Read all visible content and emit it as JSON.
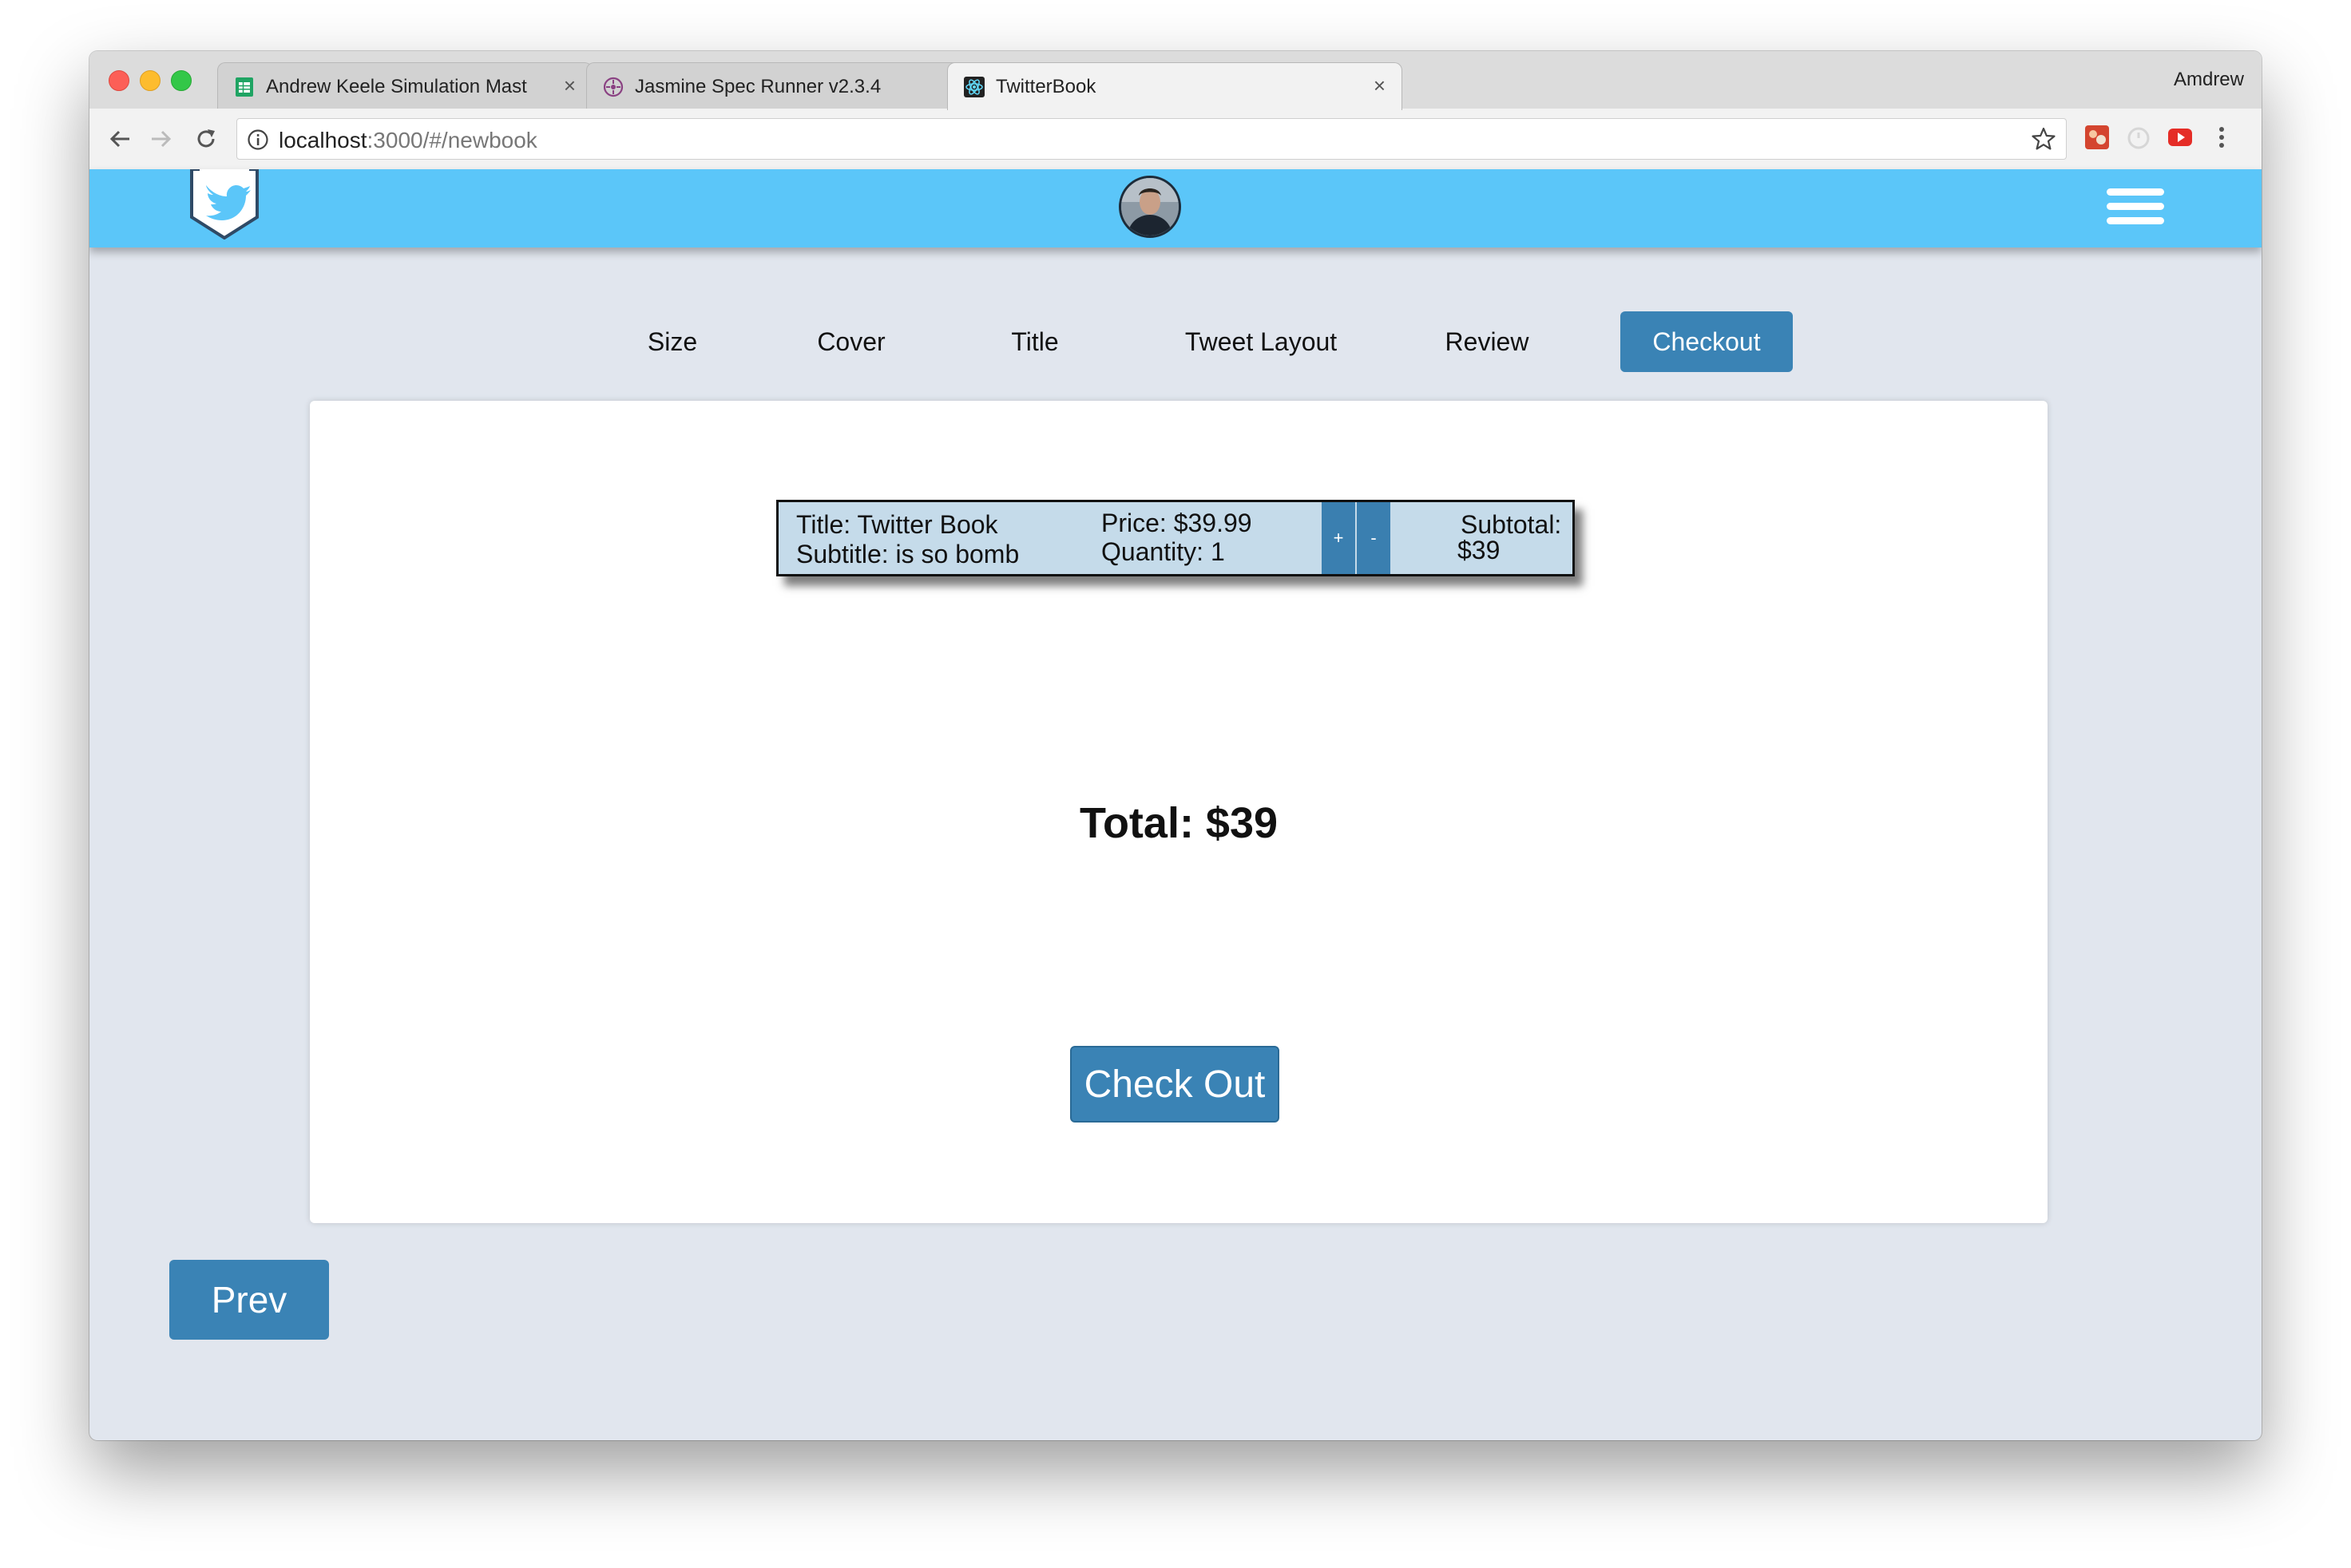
{
  "browser": {
    "tabs": [
      {
        "title": "Andrew Keele Simulation Mast",
        "icon": "sheets-icon",
        "close": "×"
      },
      {
        "title": "Jasmine Spec Runner v2.3.4",
        "icon": "jasmine-icon",
        "close": "×"
      },
      {
        "title": "TwitterBook",
        "icon": "react-icon",
        "close": "×"
      }
    ],
    "profile_name": "Amdrew",
    "url_host": "localhost",
    "url_rest": ":3000/#/newbook"
  },
  "nav": {
    "steps": [
      "Size",
      "Cover",
      "Title",
      "Tweet Layout",
      "Review",
      "Checkout"
    ],
    "active_step": "Checkout"
  },
  "cart": {
    "title_line": "Title: Twitter Book",
    "subtitle_line": "Subtitle: is so bomb",
    "price_line": "Price: $39.99",
    "quantity_line": "Quantity: 1",
    "plus_label": "+",
    "minus_label": "-",
    "subtotal_label": "Subtotal:",
    "subtotal_value": "$39"
  },
  "total_text": "Total: $39",
  "checkout_button": "Check Out",
  "prev_button": "Prev",
  "colors": {
    "header": "#5bc6f9",
    "primary_button": "#3a83b5",
    "cart_row": "#c5dbea",
    "page_bg": "#e1e6ee"
  }
}
